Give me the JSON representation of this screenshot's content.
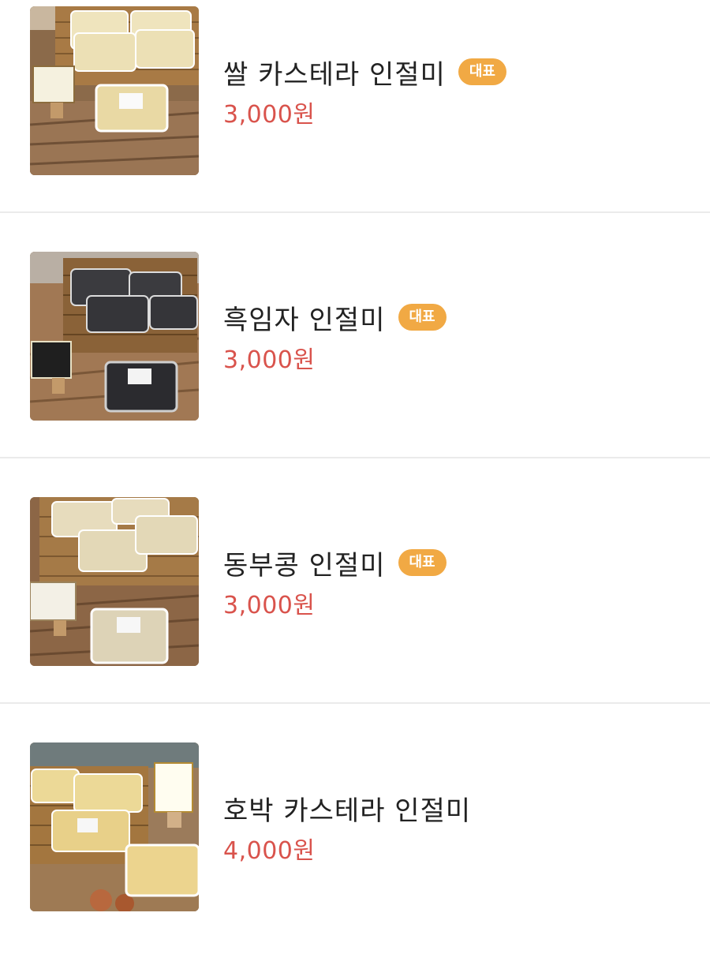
{
  "menu": {
    "items": [
      {
        "name": "쌀 카스테라 인절미",
        "badge": "대표",
        "price": "3,000원",
        "photo": "rice-castella-injeolmi-photo",
        "topping": "#e9d9a4"
      },
      {
        "name": "흑임자 인절미",
        "badge": "대표",
        "price": "3,000원",
        "photo": "black-sesame-injeolmi-photo",
        "topping": "#2b2b2f"
      },
      {
        "name": "동부콩 인절미",
        "badge": "대표",
        "price": "3,000원",
        "photo": "cowpea-injeolmi-photo",
        "topping": "#ddd3b7"
      },
      {
        "name": "호박 카스테라 인절미",
        "badge": "",
        "price": "4,000원",
        "photo": "pumpkin-castella-injeolmi-photo",
        "topping": "#ecd48e"
      }
    ]
  },
  "colors": {
    "badge": "#f1a944",
    "price": "#d9534c",
    "divider": "#ebebeb",
    "text": "#222222"
  }
}
